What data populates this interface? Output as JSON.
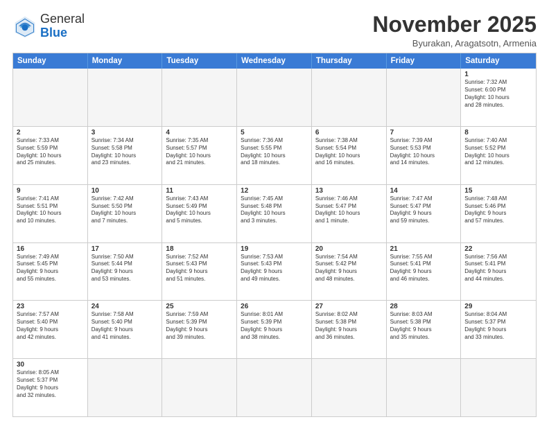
{
  "header": {
    "logo_general": "General",
    "logo_blue": "Blue",
    "month": "November 2025",
    "location": "Byurakan, Aragatsotn, Armenia"
  },
  "days_of_week": [
    "Sunday",
    "Monday",
    "Tuesday",
    "Wednesday",
    "Thursday",
    "Friday",
    "Saturday"
  ],
  "weeks": [
    [
      {
        "num": "",
        "info": ""
      },
      {
        "num": "",
        "info": ""
      },
      {
        "num": "",
        "info": ""
      },
      {
        "num": "",
        "info": ""
      },
      {
        "num": "",
        "info": ""
      },
      {
        "num": "",
        "info": ""
      },
      {
        "num": "1",
        "info": "Sunrise: 7:32 AM\nSunset: 6:00 PM\nDaylight: 10 hours\nand 28 minutes."
      }
    ],
    [
      {
        "num": "2",
        "info": "Sunrise: 7:33 AM\nSunset: 5:59 PM\nDaylight: 10 hours\nand 25 minutes."
      },
      {
        "num": "3",
        "info": "Sunrise: 7:34 AM\nSunset: 5:58 PM\nDaylight: 10 hours\nand 23 minutes."
      },
      {
        "num": "4",
        "info": "Sunrise: 7:35 AM\nSunset: 5:57 PM\nDaylight: 10 hours\nand 21 minutes."
      },
      {
        "num": "5",
        "info": "Sunrise: 7:36 AM\nSunset: 5:55 PM\nDaylight: 10 hours\nand 18 minutes."
      },
      {
        "num": "6",
        "info": "Sunrise: 7:38 AM\nSunset: 5:54 PM\nDaylight: 10 hours\nand 16 minutes."
      },
      {
        "num": "7",
        "info": "Sunrise: 7:39 AM\nSunset: 5:53 PM\nDaylight: 10 hours\nand 14 minutes."
      },
      {
        "num": "8",
        "info": "Sunrise: 7:40 AM\nSunset: 5:52 PM\nDaylight: 10 hours\nand 12 minutes."
      }
    ],
    [
      {
        "num": "9",
        "info": "Sunrise: 7:41 AM\nSunset: 5:51 PM\nDaylight: 10 hours\nand 10 minutes."
      },
      {
        "num": "10",
        "info": "Sunrise: 7:42 AM\nSunset: 5:50 PM\nDaylight: 10 hours\nand 7 minutes."
      },
      {
        "num": "11",
        "info": "Sunrise: 7:43 AM\nSunset: 5:49 PM\nDaylight: 10 hours\nand 5 minutes."
      },
      {
        "num": "12",
        "info": "Sunrise: 7:45 AM\nSunset: 5:48 PM\nDaylight: 10 hours\nand 3 minutes."
      },
      {
        "num": "13",
        "info": "Sunrise: 7:46 AM\nSunset: 5:47 PM\nDaylight: 10 hours\nand 1 minute."
      },
      {
        "num": "14",
        "info": "Sunrise: 7:47 AM\nSunset: 5:47 PM\nDaylight: 9 hours\nand 59 minutes."
      },
      {
        "num": "15",
        "info": "Sunrise: 7:48 AM\nSunset: 5:46 PM\nDaylight: 9 hours\nand 57 minutes."
      }
    ],
    [
      {
        "num": "16",
        "info": "Sunrise: 7:49 AM\nSunset: 5:45 PM\nDaylight: 9 hours\nand 55 minutes."
      },
      {
        "num": "17",
        "info": "Sunrise: 7:50 AM\nSunset: 5:44 PM\nDaylight: 9 hours\nand 53 minutes."
      },
      {
        "num": "18",
        "info": "Sunrise: 7:52 AM\nSunset: 5:43 PM\nDaylight: 9 hours\nand 51 minutes."
      },
      {
        "num": "19",
        "info": "Sunrise: 7:53 AM\nSunset: 5:43 PM\nDaylight: 9 hours\nand 49 minutes."
      },
      {
        "num": "20",
        "info": "Sunrise: 7:54 AM\nSunset: 5:42 PM\nDaylight: 9 hours\nand 48 minutes."
      },
      {
        "num": "21",
        "info": "Sunrise: 7:55 AM\nSunset: 5:41 PM\nDaylight: 9 hours\nand 46 minutes."
      },
      {
        "num": "22",
        "info": "Sunrise: 7:56 AM\nSunset: 5:41 PM\nDaylight: 9 hours\nand 44 minutes."
      }
    ],
    [
      {
        "num": "23",
        "info": "Sunrise: 7:57 AM\nSunset: 5:40 PM\nDaylight: 9 hours\nand 42 minutes."
      },
      {
        "num": "24",
        "info": "Sunrise: 7:58 AM\nSunset: 5:40 PM\nDaylight: 9 hours\nand 41 minutes."
      },
      {
        "num": "25",
        "info": "Sunrise: 7:59 AM\nSunset: 5:39 PM\nDaylight: 9 hours\nand 39 minutes."
      },
      {
        "num": "26",
        "info": "Sunrise: 8:01 AM\nSunset: 5:39 PM\nDaylight: 9 hours\nand 38 minutes."
      },
      {
        "num": "27",
        "info": "Sunrise: 8:02 AM\nSunset: 5:38 PM\nDaylight: 9 hours\nand 36 minutes."
      },
      {
        "num": "28",
        "info": "Sunrise: 8:03 AM\nSunset: 5:38 PM\nDaylight: 9 hours\nand 35 minutes."
      },
      {
        "num": "29",
        "info": "Sunrise: 8:04 AM\nSunset: 5:37 PM\nDaylight: 9 hours\nand 33 minutes."
      }
    ],
    [
      {
        "num": "30",
        "info": "Sunrise: 8:05 AM\nSunset: 5:37 PM\nDaylight: 9 hours\nand 32 minutes."
      },
      {
        "num": "",
        "info": ""
      },
      {
        "num": "",
        "info": ""
      },
      {
        "num": "",
        "info": ""
      },
      {
        "num": "",
        "info": ""
      },
      {
        "num": "",
        "info": ""
      },
      {
        "num": "",
        "info": ""
      }
    ]
  ]
}
